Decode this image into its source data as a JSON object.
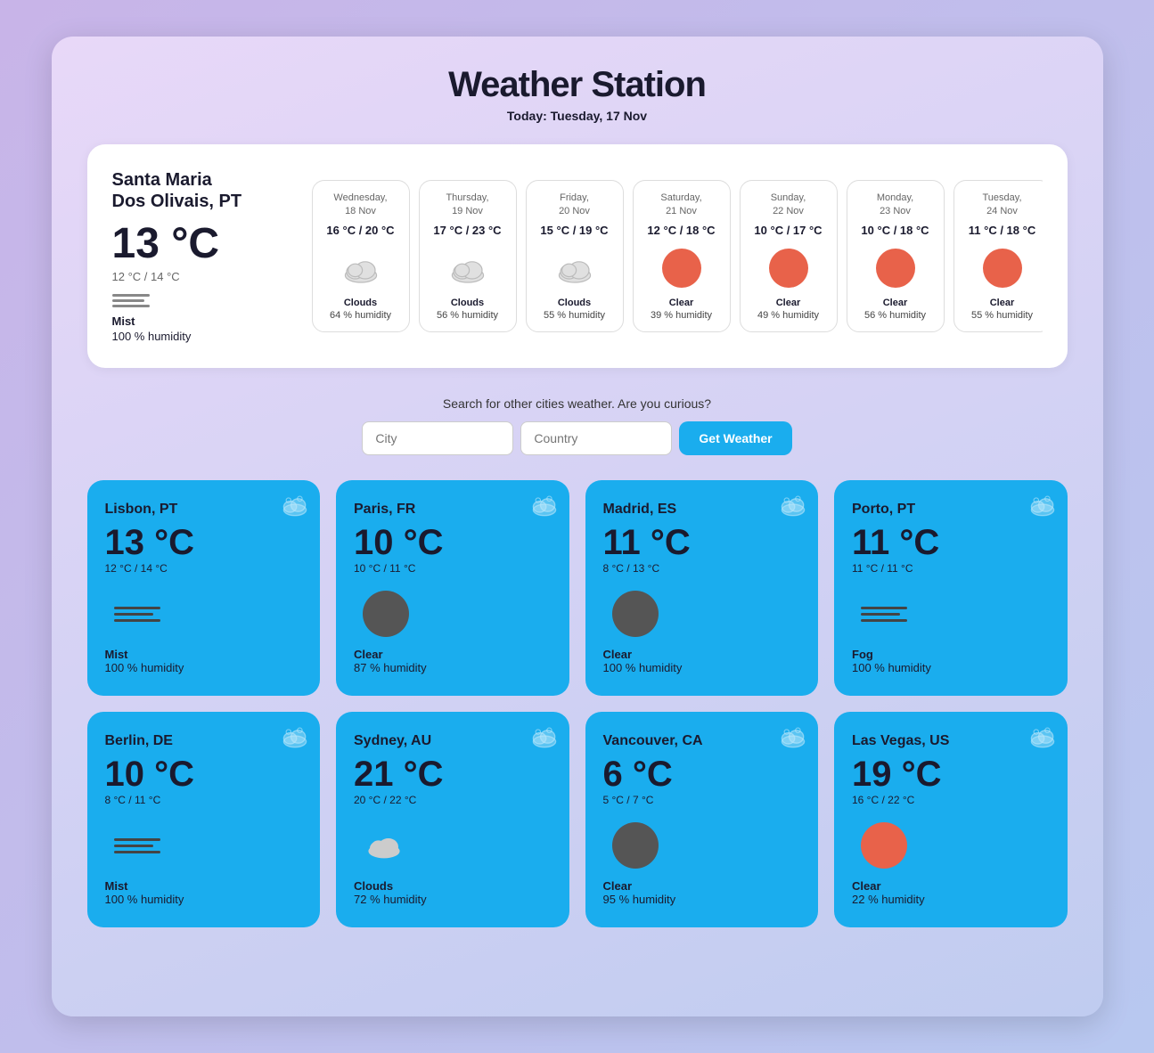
{
  "app": {
    "title": "Weather Station",
    "subtitle": "Today: Tuesday, 17 Nov"
  },
  "current": {
    "city": "Santa Maria",
    "cityline2": "Dos Olivais, PT",
    "temp": "13 °C",
    "minmax": "12 °C / 14 °C",
    "desc": "Mist",
    "humidity": "100 % humidity"
  },
  "forecast": [
    {
      "date": "Wednesday,\n18 Nov",
      "temp": "16 °C / 20 °C",
      "type": "clouds",
      "desc": "Clouds",
      "humidity": "64 % humidity"
    },
    {
      "date": "Thursday,\n19 Nov",
      "temp": "17 °C / 23 °C",
      "type": "clouds",
      "desc": "Clouds",
      "humidity": "56 % humidity"
    },
    {
      "date": "Friday,\n20 Nov",
      "temp": "15 °C / 19 °C",
      "type": "clouds",
      "desc": "Clouds",
      "humidity": "55 % humidity"
    },
    {
      "date": "Saturday,\n21 Nov",
      "temp": "12 °C / 18 °C",
      "type": "clear",
      "desc": "Clear",
      "humidity": "39 % humidity"
    },
    {
      "date": "Sunday,\n22 Nov",
      "temp": "10 °C / 17 °C",
      "type": "clear",
      "desc": "Clear",
      "humidity": "49 % humidity"
    },
    {
      "date": "Monday,\n23 Nov",
      "temp": "10 °C / 18 °C",
      "type": "clear",
      "desc": "Clear",
      "humidity": "56 % humidity"
    },
    {
      "date": "Tuesday,\n24 Nov",
      "temp": "11 °C / 18 °C",
      "type": "clear",
      "desc": "Clear",
      "humidity": "55 % humidity"
    }
  ],
  "search": {
    "label": "Search for other cities weather. Are you curious?",
    "city_placeholder": "City",
    "country_placeholder": "Country",
    "button_label": "Get Weather"
  },
  "cities": [
    {
      "name": "Lisbon, PT",
      "temp": "13 °C",
      "minmax": "12 °C / 14 °C",
      "type": "mist",
      "desc": "Mist",
      "humidity": "100 % humidity"
    },
    {
      "name": "Paris, FR",
      "temp": "10 °C",
      "minmax": "10 °C / 11 °C",
      "type": "clear_dark",
      "desc": "Clear",
      "humidity": "87 % humidity"
    },
    {
      "name": "Madrid, ES",
      "temp": "11 °C",
      "minmax": "8 °C / 13 °C",
      "type": "clear_dark",
      "desc": "Clear",
      "humidity": "100 % humidity"
    },
    {
      "name": "Porto, PT",
      "temp": "11 °C",
      "minmax": "11 °C / 11 °C",
      "type": "fog",
      "desc": "Fog",
      "humidity": "100 % humidity"
    },
    {
      "name": "Berlin, DE",
      "temp": "10 °C",
      "minmax": "8 °C / 11 °C",
      "type": "mist",
      "desc": "Mist",
      "humidity": "100 % humidity"
    },
    {
      "name": "Sydney, AU",
      "temp": "21 °C",
      "minmax": "20 °C / 22 °C",
      "type": "clouds",
      "desc": "Clouds",
      "humidity": "72 % humidity"
    },
    {
      "name": "Vancouver, CA",
      "temp": "6 °C",
      "minmax": "5 °C / 7 °C",
      "type": "clear_dark",
      "desc": "Clear",
      "humidity": "95 % humidity"
    },
    {
      "name": "Las Vegas, US",
      "temp": "19 °C",
      "minmax": "16 °C / 22 °C",
      "type": "clear",
      "desc": "Clear",
      "humidity": "22 % humidity"
    }
  ]
}
